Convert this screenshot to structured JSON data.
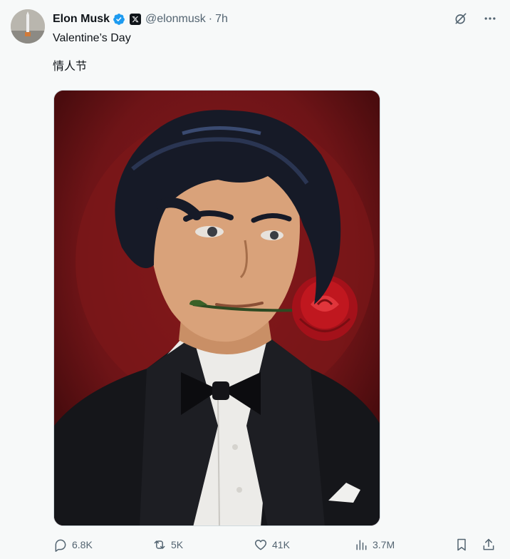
{
  "post": {
    "author": {
      "name": "Elon Musk",
      "handle": "@elonmusk",
      "separator": "·",
      "time": "7h",
      "verified": true,
      "affiliation_badge": "x-logo-icon"
    },
    "text_line_1": "Valentine’s Day",
    "text_line_2": "情人节",
    "media": {
      "type": "image",
      "description_icon": "anime-man-tuxedo-rose-illustration",
      "colors": {
        "background": "#5c0f12",
        "glow": "#8a1a1d",
        "hair": "#161a27",
        "skin": "#d9a27a",
        "suit": "#15161a",
        "shirt": "#ecebe8",
        "rose": "#c0171f"
      }
    }
  },
  "actions": {
    "replies": "6.8K",
    "reposts": "5K",
    "likes": "41K",
    "views": "3.7M"
  },
  "icons": {
    "grok": "grok-icon",
    "more": "more-icon",
    "reply": "reply-icon",
    "repost": "repost-icon",
    "like": "heart-icon",
    "views": "views-icon",
    "bookmark": "bookmark-icon",
    "share": "share-icon"
  },
  "colors": {
    "text": "#0f1419",
    "secondary": "#536471",
    "verified": "#1d9bf0",
    "background": "#f7f9f9"
  }
}
